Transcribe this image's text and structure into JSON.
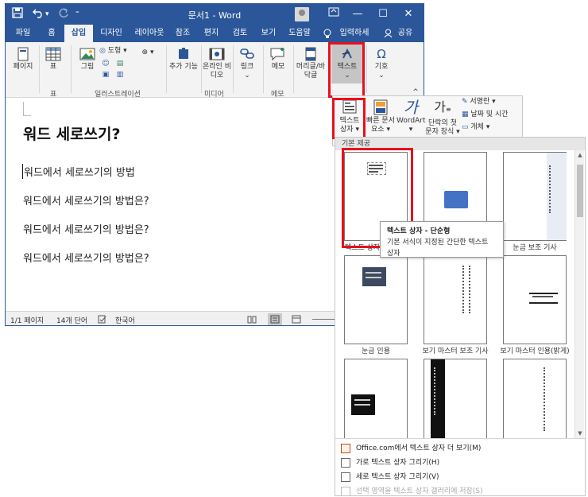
{
  "window": {
    "title": "문서1  -  Word",
    "minimize": "—",
    "restore": "☐",
    "close": "✕"
  },
  "quick_access": {
    "save_icon": "save-icon",
    "undo_icon": "undo-icon",
    "redo_icon": "redo-icon",
    "customize_icon": "customize-icon",
    "ribbon_display_icon": "ribbon-display-icon"
  },
  "tabs": [
    {
      "label": "파일"
    },
    {
      "label": "홈"
    },
    {
      "label": "삽입"
    },
    {
      "label": "디자인"
    },
    {
      "label": "레이아웃"
    },
    {
      "label": "참조"
    },
    {
      "label": "편지"
    },
    {
      "label": "검토"
    },
    {
      "label": "보기"
    },
    {
      "label": "도움말"
    },
    {
      "label": "입력하세"
    },
    {
      "label": "공유"
    }
  ],
  "ribbon": {
    "page": "페이지",
    "table": "표",
    "table_group": "표",
    "picture": "그림",
    "shapes": "도형",
    "illustrations_group": "일러스트레이션",
    "addins": "추가 기능",
    "online_video": "온라인 비디오",
    "media_group": "미디어",
    "link": "링크",
    "memo": "메모",
    "memo_group": "메모",
    "header_footer": "머리글/바닥글",
    "text": "텍스트",
    "symbol": "기호",
    "dropdown_arrow": "⌄"
  },
  "document": {
    "heading": "워드  세로쓰기?",
    "lines": [
      "워드에서 세로쓰기의 방법",
      "워드에서 세로쓰기의 방법은?",
      "워드에서 세로쓰기의 방법은?",
      "워드에서 세로쓰기의 방법은?"
    ]
  },
  "status": {
    "page": "1/1 페이지",
    "words": "14개 단어",
    "language": "한국어"
  },
  "flyout": {
    "textbox": "텍스트 상자",
    "quick_parts": "빠른 문서 요소",
    "wordart": "WordArt",
    "dropcap": "단락의 첫 문자 장식",
    "signature": "서명란",
    "datetime": "날짜 및 시간",
    "object": "개체"
  },
  "gallery": {
    "header": "기본 제공",
    "items": [
      {
        "label": "텍스트 상자 - 단순형"
      },
      {
        "label": ""
      },
      {
        "label": "눈금 보조 기사"
      },
      {
        "label": "눈금 인용"
      },
      {
        "label": "보기 마스터 보조 기사"
      },
      {
        "label": "보기 마스터 인용(밝게)"
      },
      {
        "label": ""
      },
      {
        "label": ""
      },
      {
        "label": ""
      }
    ],
    "tooltip_title": "텍스트 상자 - 단순형",
    "tooltip_desc": "기본 서식이 지정된 간단한 텍스트 상자",
    "menu": [
      {
        "label": "Office.com에서 텍스트 상자 더 보기(M)",
        "enabled": true
      },
      {
        "label": "가로 텍스트 상자 그리기(H)",
        "enabled": true
      },
      {
        "label": "세로 텍스트 상자 그리기(V)",
        "enabled": true
      },
      {
        "label": "선택 영역을 텍스트 상자 갤러리에 저장(S)",
        "enabled": false
      }
    ]
  },
  "colors": {
    "word_blue": "#2b579a",
    "highlight_red": "#e8101e"
  }
}
